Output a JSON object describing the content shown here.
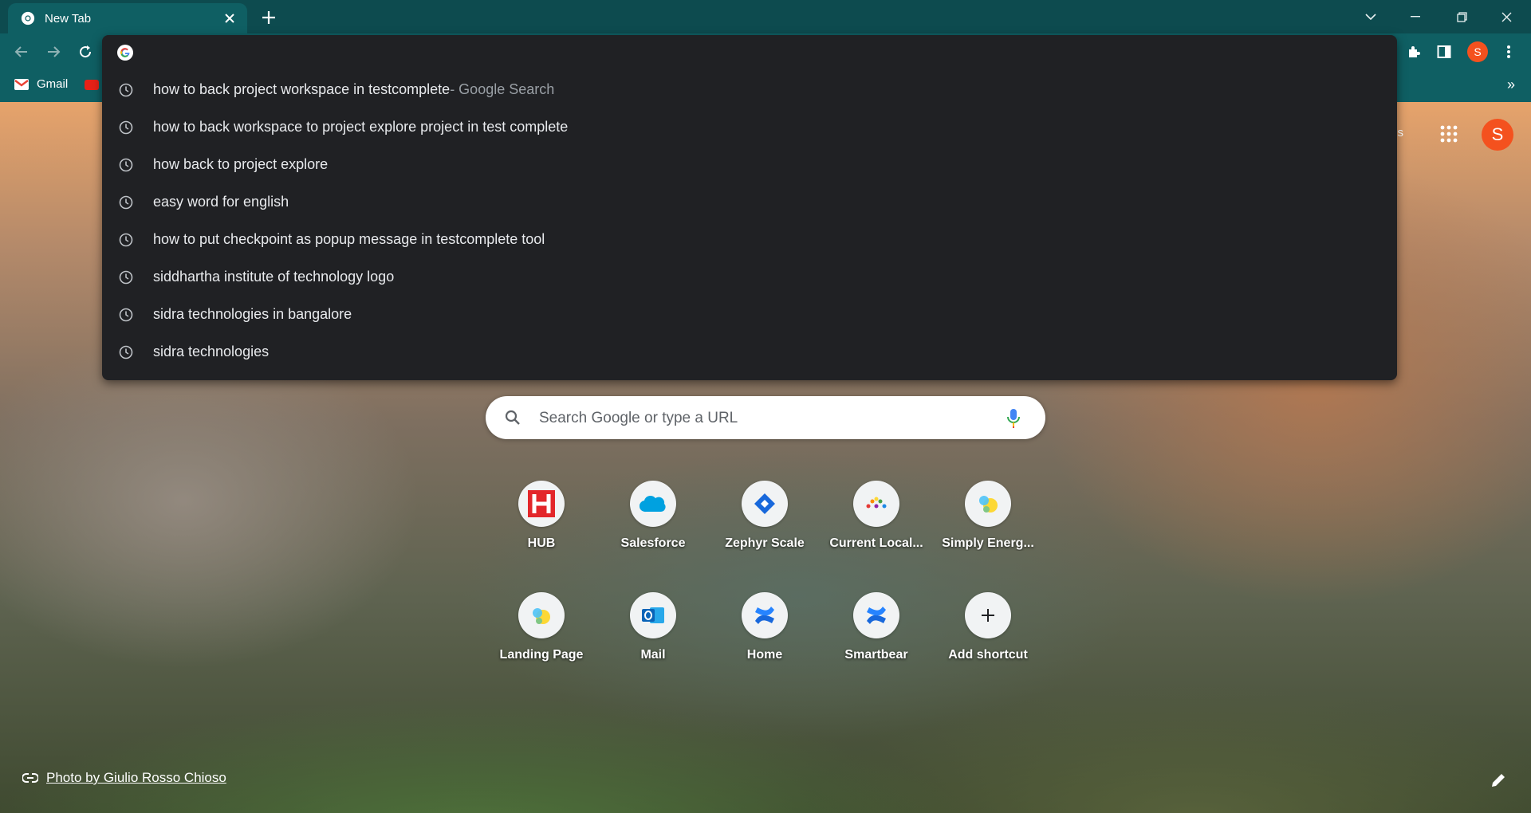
{
  "tab": {
    "title": "New Tab"
  },
  "bookmarks": {
    "gmail_label": "Gmail",
    "more": "»"
  },
  "toolbar": {
    "profile_initial": "S"
  },
  "omnibox": {
    "value": "",
    "suggestions": [
      {
        "text": "how to back project workspace in testcomplete",
        "suffix": " - Google Search"
      },
      {
        "text": "how to back workspace to project explore project in test complete",
        "suffix": ""
      },
      {
        "text": "how back to project explore",
        "suffix": ""
      },
      {
        "text": "easy word for english",
        "suffix": ""
      },
      {
        "text": "how to put checkpoint as popup message in testcomplete tool",
        "suffix": ""
      },
      {
        "text": "siddhartha institute of technology logo",
        "suffix": ""
      },
      {
        "text": "sidra technologies in bangalore",
        "suffix": ""
      },
      {
        "text": "sidra technologies",
        "suffix": ""
      }
    ]
  },
  "ntp": {
    "links_partial": "ges",
    "avatar_initial": "S",
    "search_placeholder": "Search Google or type a URL",
    "shortcuts": [
      {
        "label": "HUB",
        "icon": "hub-icon"
      },
      {
        "label": "Salesforce",
        "icon": "salesforce-cloud-icon"
      },
      {
        "label": "Zephyr Scale",
        "icon": "zephyr-diamond-icon"
      },
      {
        "label": "Current Local...",
        "icon": "current-local-icon"
      },
      {
        "label": "Simply Energ...",
        "icon": "simply-energy-icon"
      },
      {
        "label": "Landing Page",
        "icon": "landing-page-icon"
      },
      {
        "label": "Mail",
        "icon": "outlook-icon"
      },
      {
        "label": "Home",
        "icon": "confluence-icon"
      },
      {
        "label": "Smartbear",
        "icon": "confluence-icon"
      },
      {
        "label": "Add shortcut",
        "icon": "plus-icon"
      }
    ],
    "attribution": "Photo by Giulio Rosso Chioso"
  },
  "colors": {
    "tabstrip": "#0d4b4f",
    "toolbar": "#0f5f63",
    "dropdown": "#202124",
    "avatar": "#f4511e"
  }
}
